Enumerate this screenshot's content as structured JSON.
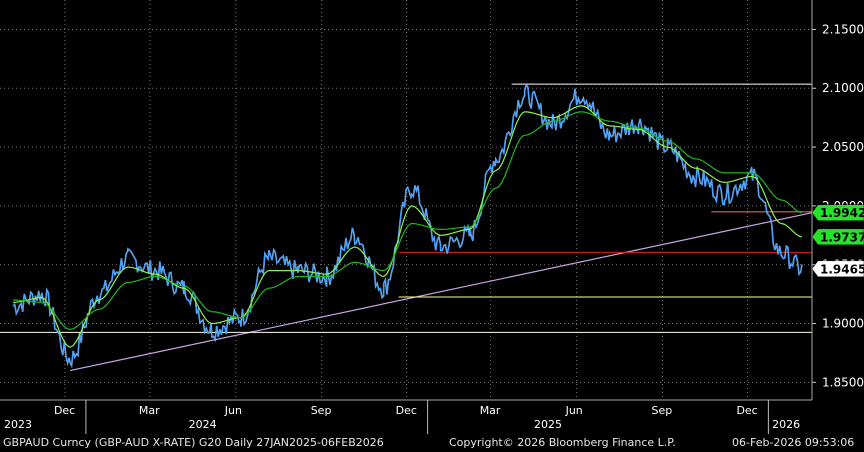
{
  "chart_data": {
    "type": "line",
    "instrument": "GBPAUD Curncy (GBP-AUD X-RATE) G20 Daily 27JAN2025-06FEB2026",
    "copyright": "Copyright© 2026 Bloomberg Finance L.P.",
    "timestamp": "06-Feb-2026 09:53:06",
    "ylim": [
      1.835,
      2.175
    ],
    "yticks": [
      "1.8500",
      "1.9000",
      "1.9500",
      "2.0000",
      "2.0500",
      "2.1000",
      "2.1500"
    ],
    "x_month_labels": [
      "Dec",
      "Mar",
      "Jun",
      "Sep",
      "Dec",
      "Mar",
      "Jun",
      "Sep",
      "Dec"
    ],
    "x_year_labels": [
      "2023",
      "2024",
      "2025",
      "2026"
    ],
    "price_labels": [
      {
        "value": "1.9942",
        "color": "#27e22b"
      },
      {
        "value": "1.9737",
        "color": "#27e22b"
      },
      {
        "value": "1.9465",
        "color": "#ffffff"
      }
    ],
    "series": [
      {
        "role": "price",
        "color": "#4aa3ff",
        "x": [
          "2023-10",
          "2023-11",
          "2023-12",
          "2024-01",
          "2024-02",
          "2024-03",
          "2024-04",
          "2024-05",
          "2024-06",
          "2024-07",
          "2024-08",
          "2024-09",
          "2024-10",
          "2024-11",
          "2024-12",
          "2025-01",
          "2025-02",
          "2025-03",
          "2025-04",
          "2025-05",
          "2025-06",
          "2025-07",
          "2025-08",
          "2025-09",
          "2025-10",
          "2025-11",
          "2025-12",
          "2026-01",
          "2026-02"
        ],
        "values": [
          1.915,
          1.925,
          1.87,
          1.925,
          1.955,
          1.945,
          1.93,
          1.895,
          1.905,
          1.955,
          1.945,
          1.94,
          1.975,
          1.93,
          2.015,
          1.965,
          1.975,
          2.04,
          2.095,
          2.07,
          2.095,
          2.06,
          2.07,
          2.05,
          2.025,
          2.01,
          2.025,
          1.96,
          1.9465
        ]
      },
      {
        "role": "moving-average-short",
        "color": "#8ef04f",
        "x": [
          "2023-10",
          "2023-11",
          "2023-12",
          "2024-01",
          "2024-02",
          "2024-03",
          "2024-04",
          "2024-05",
          "2024-06",
          "2024-07",
          "2024-08",
          "2024-09",
          "2024-10",
          "2024-11",
          "2024-12",
          "2025-01",
          "2025-02",
          "2025-03",
          "2025-04",
          "2025-05",
          "2025-06",
          "2025-07",
          "2025-08",
          "2025-09",
          "2025-10",
          "2025-11",
          "2025-12",
          "2026-01",
          "2026-02"
        ],
        "values": [
          1.918,
          1.922,
          1.88,
          1.92,
          1.948,
          1.942,
          1.93,
          1.9,
          1.905,
          1.945,
          1.945,
          1.942,
          1.965,
          1.94,
          2.0,
          1.975,
          1.98,
          2.03,
          2.08,
          2.075,
          2.085,
          2.068,
          2.065,
          2.05,
          2.032,
          2.02,
          2.025,
          1.985,
          1.9737
        ]
      },
      {
        "role": "moving-average-long",
        "color": "#1fb81f",
        "x": [
          "2023-10",
          "2023-11",
          "2023-12",
          "2024-01",
          "2024-02",
          "2024-03",
          "2024-04",
          "2024-05",
          "2024-06",
          "2024-07",
          "2024-08",
          "2024-09",
          "2024-10",
          "2024-11",
          "2024-12",
          "2025-01",
          "2025-02",
          "2025-03",
          "2025-04",
          "2025-05",
          "2025-06",
          "2025-07",
          "2025-08",
          "2025-09",
          "2025-10",
          "2025-11",
          "2025-12",
          "2026-01",
          "2026-02"
        ],
        "values": [
          1.92,
          1.918,
          1.895,
          1.912,
          1.935,
          1.94,
          1.932,
          1.91,
          1.905,
          1.93,
          1.94,
          1.94,
          1.952,
          1.945,
          1.985,
          1.98,
          1.982,
          2.015,
          2.06,
          2.072,
          2.08,
          2.072,
          2.066,
          2.055,
          2.04,
          2.028,
          2.028,
          2.005,
          1.9942
        ]
      }
    ],
    "annotations": [
      {
        "kind": "trendline",
        "color": "#c7a6e6",
        "from": {
          "x": "2023-12",
          "y": 1.86
        },
        "to": {
          "x": "2026-02",
          "y": 1.9942
        }
      },
      {
        "kind": "hline",
        "color": "#ffffff",
        "y": 2.1035,
        "x_from": "2025-04",
        "x_to": "2026-02"
      },
      {
        "kind": "hline",
        "color": "#ffffff",
        "y": 1.995,
        "x_from": "2025-11",
        "x_to": "2026-02"
      },
      {
        "kind": "hline",
        "color": "#e02020",
        "y": 1.995,
        "x_from": "2025-11",
        "x_to": "2026-02"
      },
      {
        "kind": "hline",
        "color": "#e02020",
        "y": 1.9605,
        "x_from": "2024-12",
        "x_to": "2026-02"
      },
      {
        "kind": "hline",
        "color": "#ffff99",
        "y": 1.9225,
        "x_from": "2024-12",
        "x_to": "2026-02"
      },
      {
        "kind": "hline",
        "color": "#ffffee",
        "y": 1.8925,
        "x_from": "2023-10",
        "x_to": "2026-02"
      }
    ]
  }
}
